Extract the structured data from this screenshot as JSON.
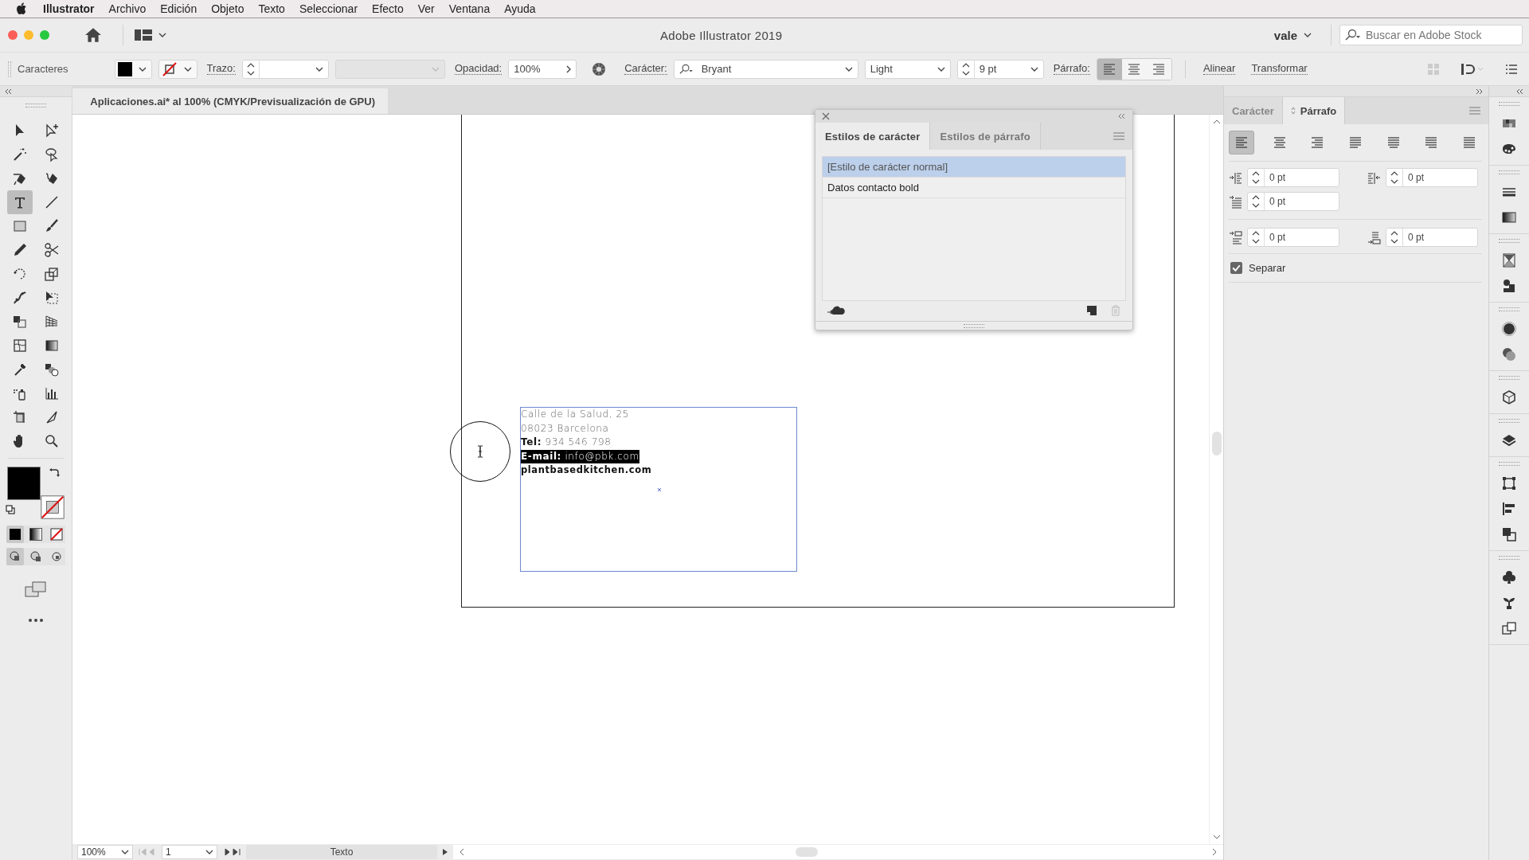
{
  "menu_bar": {
    "app": "Illustrator",
    "items": [
      "Archivo",
      "Edición",
      "Objeto",
      "Texto",
      "Seleccionar",
      "Efecto",
      "Ver",
      "Ventana",
      "Ayuda"
    ]
  },
  "window": {
    "title": "Adobe Illustrator 2019",
    "user": "vale",
    "search": {
      "placeholder": "Buscar en Adobe Stock"
    }
  },
  "control_bar": {
    "label": "Caracteres",
    "stroke_label": "Trazo:",
    "opacity_label": "Opacidad:",
    "opacity": "100%",
    "character_label": "Carácter:",
    "font": "Bryant",
    "style": "Light",
    "size": "9 pt",
    "paragraph_label": "Párrafo:",
    "align": [
      {
        "selected": true
      },
      {
        "selected": false
      },
      {
        "selected": false
      }
    ],
    "links": [
      "Alinear",
      "Transformar"
    ]
  },
  "document_tab": {
    "title": "Aplicaciones.ai* al 100% (CMYK/Previsualización de GPU)"
  },
  "tools": [
    {
      "kind": "selection",
      "selected": false
    },
    {
      "kind": "direct-selection",
      "selected": false
    },
    {
      "kind": "magic-wand",
      "selected": false
    },
    {
      "kind": "lasso",
      "selected": false
    },
    {
      "kind": "pen",
      "selected": false
    },
    {
      "kind": "curvature",
      "selected": false
    },
    {
      "kind": "type",
      "selected": true
    },
    {
      "kind": "line",
      "selected": false
    },
    {
      "kind": "rectangle",
      "selected": false
    },
    {
      "kind": "paintbrush",
      "selected": false
    },
    {
      "kind": "pencil",
      "selected": false
    },
    {
      "kind": "scissors",
      "selected": false
    },
    {
      "kind": "rotate",
      "selected": false
    },
    {
      "kind": "scale",
      "selected": false
    },
    {
      "kind": "warp",
      "selected": false
    },
    {
      "kind": "free-transform",
      "selected": false
    },
    {
      "kind": "shape-builder",
      "selected": false
    },
    {
      "kind": "perspective",
      "selected": false
    },
    {
      "kind": "mesh",
      "selected": false
    },
    {
      "kind": "gradient",
      "selected": false
    },
    {
      "kind": "eyedropper",
      "selected": false
    },
    {
      "kind": "blend",
      "selected": false
    },
    {
      "kind": "symbol-sprayer",
      "selected": false
    },
    {
      "kind": "graph",
      "selected": false
    },
    {
      "kind": "artboard",
      "selected": false
    },
    {
      "kind": "slice",
      "selected": false
    },
    {
      "kind": "hand",
      "selected": false
    },
    {
      "kind": "zoom",
      "selected": false
    }
  ],
  "artboard_text": [
    {
      "text": "Calle de la Salud, 25",
      "bold": false,
      "selected": false
    },
    {
      "text": "08023 Barcelona",
      "bold": false,
      "selected": false
    },
    {
      "text": "**Tel:** 934 546 798",
      "bold": false,
      "selected": false
    },
    {
      "text": "**E-mail:** info@pbk.com",
      "bold": false,
      "selected": true
    },
    {
      "text": "plantbasedkitchen.com",
      "bold": true,
      "selected": false
    }
  ],
  "styles_panel": {
    "tabs": [
      {
        "label": "Estilos de carácter",
        "selected": true
      },
      {
        "label": "Estilos de párrafo",
        "selected": false
      }
    ],
    "styles": [
      {
        "name": "[Estilo de carácter normal]",
        "selected": true
      },
      {
        "name": "Datos contacto bold",
        "selected": false
      }
    ]
  },
  "paragraph_panel": {
    "tabs": [
      {
        "label": "Carácter",
        "selected": false
      },
      {
        "label": "Párrafo",
        "selected": true
      }
    ],
    "align": [
      {
        "selected": true
      },
      {
        "selected": false
      },
      {
        "selected": false
      },
      {
        "selected": false
      },
      {
        "selected": false
      },
      {
        "selected": false
      },
      {
        "selected": false
      }
    ],
    "fields": [
      {
        "kind": "left-indent",
        "value": "0 pt"
      },
      {
        "kind": "right-indent",
        "value": "0 pt"
      },
      {
        "kind": "first-line",
        "value": "0 pt"
      },
      {
        "kind": "space-before",
        "value": "0 pt"
      },
      {
        "kind": "space-after",
        "value": "0 pt"
      }
    ],
    "hyphenate": {
      "label": "Separar",
      "checked": true
    }
  },
  "status_bar": {
    "zoom": "100%",
    "artboard": "1",
    "tool": "Texto"
  }
}
